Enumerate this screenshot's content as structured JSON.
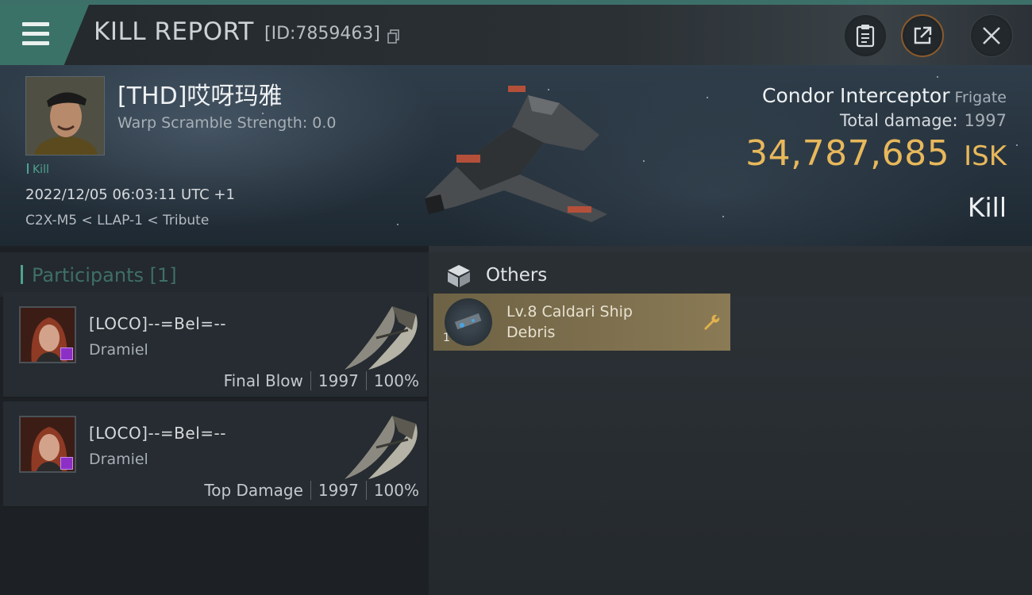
{
  "header": {
    "title": "KILL REPORT",
    "report_id": "[ID:7859463]"
  },
  "victim": {
    "name": "[THD]哎呀玛雅",
    "warp_scramble": "Warp Scramble Strength: 0.0",
    "tag": "Kill",
    "datetime": "2022/12/05 06:03:11 UTC +1",
    "location": "C2X-M5 < LLAP-1 < Tribute"
  },
  "ship": {
    "name": "Condor Interceptor",
    "class": "Frigate",
    "total_damage_label": "Total damage:",
    "total_damage_value": "1997",
    "isk_value": "34,787,685",
    "isk_label": "ISK",
    "result": "Kill"
  },
  "participants": {
    "label": "Participants",
    "count": "[1]",
    "rows": [
      {
        "corp": "[LOCO]--=Bel=--",
        "name": "Dramiel",
        "role": "Final Blow",
        "damage": "1997",
        "percent": "100%"
      },
      {
        "corp": "[LOCO]--=Bel=--",
        "name": "Dramiel",
        "role": "Top Damage",
        "damage": "1997",
        "percent": "100%"
      }
    ]
  },
  "others": {
    "label": "Others",
    "items": [
      {
        "name_line1": "Lv.8 Caldari Ship",
        "name_line2": "Debris",
        "quantity": "1",
        "icon": "wrench-icon"
      }
    ]
  },
  "colors": {
    "accent_teal": "#3a7268",
    "isk_gold": "#e8b85b",
    "item_bg": "#8a7a55"
  }
}
